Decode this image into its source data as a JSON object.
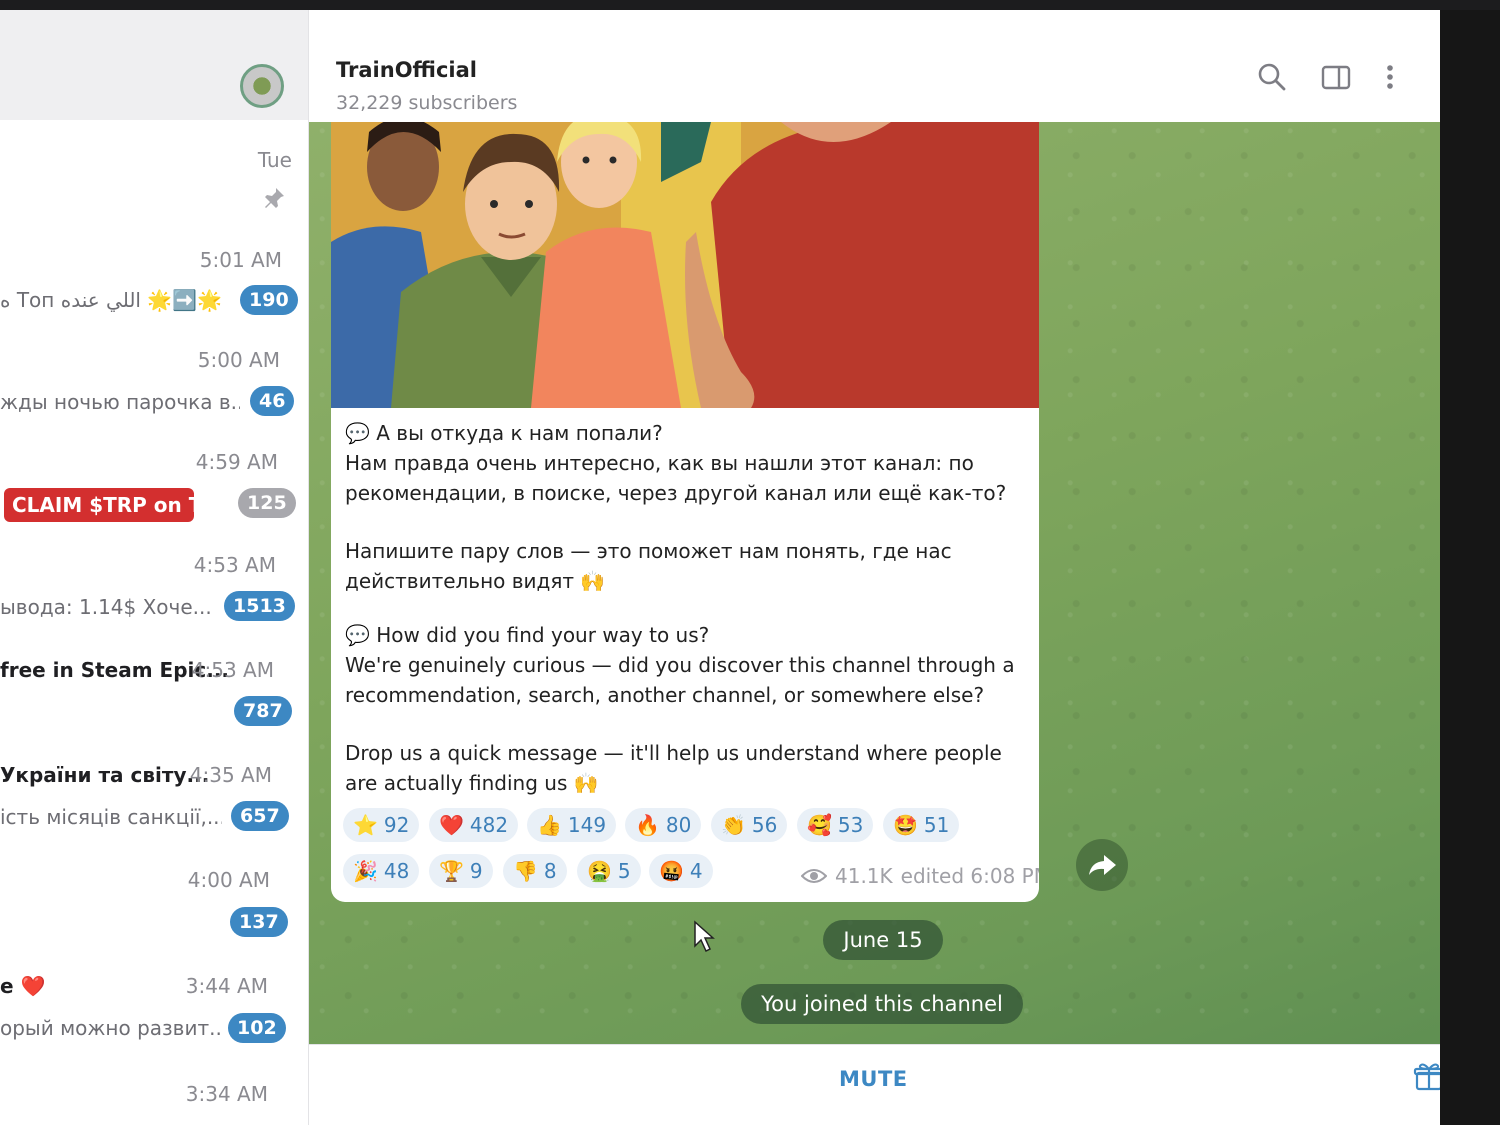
{
  "window": {
    "minimize": "—",
    "restore": "❐",
    "close": "✕"
  },
  "sidebar": {
    "top_time": "Tue",
    "chats": [
      {
        "time": "5:01 AM",
        "preview": "ه Топ اللي عنده 🌟➡️🌟",
        "badge": "190"
      },
      {
        "time": "5:00 AM",
        "preview": "жды ночью парочка в...",
        "badge": "46"
      },
      {
        "time": "4:59 AM",
        "preview": "CLAIM $TRP on T...",
        "badge": "125"
      },
      {
        "time": "4:53 AM",
        "preview": "ывода: 1.14$  Хоче...",
        "badge": "1513"
      },
      {
        "time": "4:53 AM",
        "title": "free in Steam Epic...",
        "badge": "787"
      },
      {
        "time": "4:35 AM",
        "title": "України та світу...",
        "preview": "iсть місяців санкції,...",
        "badge": "657"
      },
      {
        "time": "4:00 AM",
        "badge": "137"
      },
      {
        "time": "3:44 AM",
        "title": "e ❤️",
        "preview": "орый можно развит...",
        "badge": "102"
      },
      {
        "time": "3:34 AM"
      }
    ]
  },
  "header": {
    "title": "TrainOfficial",
    "subtitle": "32,229 subscribers"
  },
  "message": {
    "ru_heading": "💬 А вы откуда к нам попали?",
    "ru_line1": "Нам правда очень интересно, как вы нашли этот канал: по",
    "ru_line2": "рекомендации, в поиске, через другой канал или ещё как-то?",
    "ru_line3": "Напишите пару слов — это поможет нам понять, где нас",
    "ru_line4": "действительно видят 🙌",
    "en_heading": "💬 How did you find your way to us?",
    "en_line1": "We're genuinely curious — did you discover this channel through a",
    "en_line2": "recommendation, search, another channel, or somewhere else?",
    "en_line3": "Drop us a quick message — it'll help us understand where people",
    "en_line4": "are actually finding us 🙌",
    "reactions": [
      {
        "emoji": "⭐",
        "count": "92"
      },
      {
        "emoji": "❤️",
        "count": "482"
      },
      {
        "emoji": "👍",
        "count": "149"
      },
      {
        "emoji": "🔥",
        "count": "80"
      },
      {
        "emoji": "👏",
        "count": "56"
      },
      {
        "emoji": "🥰",
        "count": "53"
      },
      {
        "emoji": "🤩",
        "count": "51"
      },
      {
        "emoji": "🎉",
        "count": "48"
      },
      {
        "emoji": "🏆",
        "count": "9"
      },
      {
        "emoji": "👎",
        "count": "8"
      },
      {
        "emoji": "🤮",
        "count": "5"
      },
      {
        "emoji": "🤬",
        "count": "4"
      }
    ],
    "views": "41.1K",
    "edited": "edited 6:08 PM"
  },
  "service": {
    "date": "June 15",
    "joined": "You joined this channel"
  },
  "bottom": {
    "mute_label": "MUTE"
  },
  "colors": {
    "accent": "#3d88c3",
    "bubble": "#ffffff",
    "wallpaper": "#7ea55c"
  }
}
